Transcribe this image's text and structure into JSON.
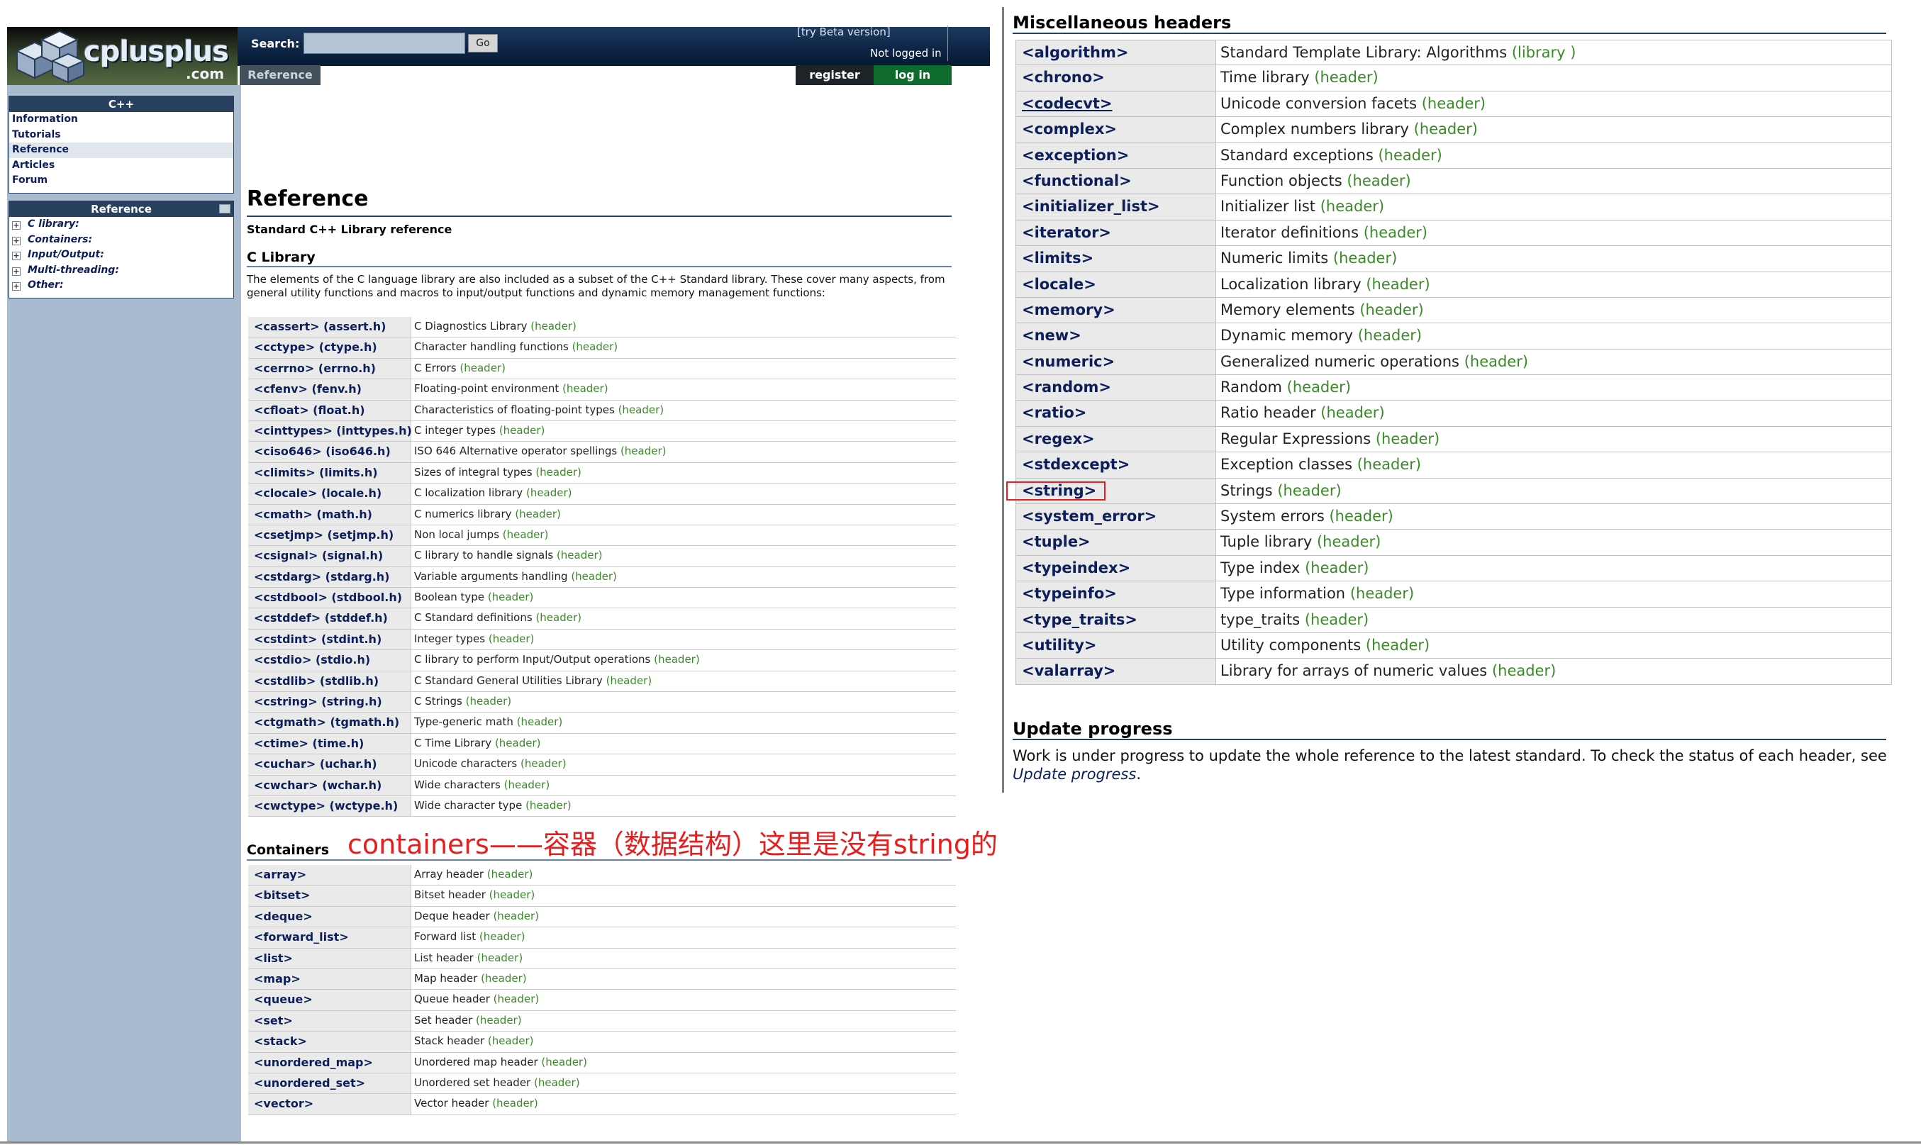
{
  "header": {
    "logo_text": "cplusplus",
    "logo_suffix": ".com",
    "search_label": "Search:",
    "search_value": "",
    "go_label": "Go",
    "beta_link": "[try Beta version]",
    "login_status": "Not logged in",
    "reference_tab": "Reference",
    "register_label": "register",
    "login_label": "log in"
  },
  "sidebar": {
    "cpp_title": "C++",
    "cpp_items": [
      "Information",
      "Tutorials",
      "Reference",
      "Articles",
      "Forum"
    ],
    "active_item": "Reference",
    "reference_title": "Reference",
    "reference_items": [
      "C library:",
      "Containers:",
      "Input/Output:",
      "Multi-threading:",
      "Other:"
    ]
  },
  "main": {
    "title": "Reference",
    "subtitle": "Standard C++ Library reference",
    "clib_title": "C Library",
    "clib_desc": "The elements of the C language library are also included as a subset of the C++ Standard library. These cover many aspects, from general utility functions and macros to input/output functions and dynamic memory management functions:",
    "clib_rows": [
      {
        "name": "<cassert> (assert.h)",
        "desc": "C Diagnostics Library",
        "tag": "(header)"
      },
      {
        "name": "<cctype> (ctype.h)",
        "desc": "Character handling functions",
        "tag": "(header)"
      },
      {
        "name": "<cerrno> (errno.h)",
        "desc": "C Errors",
        "tag": "(header)"
      },
      {
        "name": "<cfenv> (fenv.h)",
        "desc": "Floating-point environment",
        "tag": "(header)"
      },
      {
        "name": "<cfloat> (float.h)",
        "desc": "Characteristics of floating-point types",
        "tag": "(header)"
      },
      {
        "name": "<cinttypes> (inttypes.h)",
        "desc": "C integer types",
        "tag": "(header)"
      },
      {
        "name": "<ciso646> (iso646.h)",
        "desc": "ISO 646 Alternative operator spellings",
        "tag": "(header)"
      },
      {
        "name": "<climits> (limits.h)",
        "desc": "Sizes of integral types",
        "tag": "(header)"
      },
      {
        "name": "<clocale> (locale.h)",
        "desc": "C localization library",
        "tag": "(header)"
      },
      {
        "name": "<cmath> (math.h)",
        "desc": "C numerics library",
        "tag": "(header)"
      },
      {
        "name": "<csetjmp> (setjmp.h)",
        "desc": "Non local jumps",
        "tag": "(header)"
      },
      {
        "name": "<csignal> (signal.h)",
        "desc": "C library to handle signals",
        "tag": "(header)"
      },
      {
        "name": "<cstdarg> (stdarg.h)",
        "desc": "Variable arguments handling",
        "tag": "(header)"
      },
      {
        "name": "<cstdbool> (stdbool.h)",
        "desc": "Boolean type",
        "tag": "(header)"
      },
      {
        "name": "<cstddef> (stddef.h)",
        "desc": "C Standard definitions",
        "tag": "(header)"
      },
      {
        "name": "<cstdint> (stdint.h)",
        "desc": "Integer types",
        "tag": "(header)"
      },
      {
        "name": "<cstdio> (stdio.h)",
        "desc": "C library to perform Input/Output operations",
        "tag": "(header)"
      },
      {
        "name": "<cstdlib> (stdlib.h)",
        "desc": "C Standard General Utilities Library",
        "tag": "(header)"
      },
      {
        "name": "<cstring> (string.h)",
        "desc": "C Strings",
        "tag": "(header)"
      },
      {
        "name": "<ctgmath> (tgmath.h)",
        "desc": "Type-generic math",
        "tag": "(header)"
      },
      {
        "name": "<ctime> (time.h)",
        "desc": "C Time Library",
        "tag": "(header)"
      },
      {
        "name": "<cuchar> (uchar.h)",
        "desc": "Unicode characters",
        "tag": "(header)"
      },
      {
        "name": "<cwchar> (wchar.h)",
        "desc": "Wide characters",
        "tag": "(header)"
      },
      {
        "name": "<cwctype> (wctype.h)",
        "desc": "Wide character type",
        "tag": "(header)"
      }
    ],
    "annotation": "containers——容器（数据结构）这里是没有string的",
    "containers_title": "Containers",
    "containers_rows": [
      {
        "name": "<array>",
        "desc": "Array header",
        "tag": "(header)"
      },
      {
        "name": "<bitset>",
        "desc": "Bitset header",
        "tag": "(header)"
      },
      {
        "name": "<deque>",
        "desc": "Deque header",
        "tag": "(header)"
      },
      {
        "name": "<forward_list>",
        "desc": "Forward list",
        "tag": "(header)"
      },
      {
        "name": "<list>",
        "desc": "List header",
        "tag": "(header)"
      },
      {
        "name": "<map>",
        "desc": "Map header",
        "tag": "(header)"
      },
      {
        "name": "<queue>",
        "desc": "Queue header",
        "tag": "(header)"
      },
      {
        "name": "<set>",
        "desc": "Set header",
        "tag": "(header)"
      },
      {
        "name": "<stack>",
        "desc": "Stack header",
        "tag": "(header)"
      },
      {
        "name": "<unordered_map>",
        "desc": "Unordered map header",
        "tag": "(header)"
      },
      {
        "name": "<unordered_set>",
        "desc": "Unordered set header",
        "tag": "(header)"
      },
      {
        "name": "<vector>",
        "desc": "Vector header",
        "tag": "(header)"
      }
    ]
  },
  "misc": {
    "title": "Miscellaneous headers",
    "rows": [
      {
        "name": "<algorithm>",
        "desc": "Standard Template Library: Algorithms",
        "tag": "(library )"
      },
      {
        "name": "<chrono>",
        "desc": "Time library",
        "tag": "(header)"
      },
      {
        "name": "<codecvt>",
        "desc": "Unicode conversion facets",
        "tag": "(header)"
      },
      {
        "name": "<complex>",
        "desc": "Complex numbers library",
        "tag": "(header)"
      },
      {
        "name": "<exception>",
        "desc": "Standard exceptions",
        "tag": "(header)"
      },
      {
        "name": "<functional>",
        "desc": "Function objects",
        "tag": "(header)"
      },
      {
        "name": "<initializer_list>",
        "desc": "Initializer list",
        "tag": "(header)"
      },
      {
        "name": "<iterator>",
        "desc": "Iterator definitions",
        "tag": "(header)"
      },
      {
        "name": "<limits>",
        "desc": "Numeric limits",
        "tag": "(header)"
      },
      {
        "name": "<locale>",
        "desc": "Localization library",
        "tag": "(header)"
      },
      {
        "name": "<memory>",
        "desc": "Memory elements",
        "tag": "(header)"
      },
      {
        "name": "<new>",
        "desc": "Dynamic memory",
        "tag": "(header)"
      },
      {
        "name": "<numeric>",
        "desc": "Generalized numeric operations",
        "tag": "(header)"
      },
      {
        "name": "<random>",
        "desc": "Random",
        "tag": "(header)"
      },
      {
        "name": "<ratio>",
        "desc": "Ratio header",
        "tag": "(header)"
      },
      {
        "name": "<regex>",
        "desc": "Regular Expressions",
        "tag": "(header)"
      },
      {
        "name": "<stdexcept>",
        "desc": "Exception classes",
        "tag": "(header)"
      },
      {
        "name": "<string>",
        "desc": "Strings",
        "tag": "(header)"
      },
      {
        "name": "<system_error>",
        "desc": "System errors",
        "tag": "(header)"
      },
      {
        "name": "<tuple>",
        "desc": "Tuple library",
        "tag": "(header)"
      },
      {
        "name": "<typeindex>",
        "desc": "Type index",
        "tag": "(header)"
      },
      {
        "name": "<typeinfo>",
        "desc": "Type information",
        "tag": "(header)"
      },
      {
        "name": "<type_traits>",
        "desc": "type_traits",
        "tag": "(header)"
      },
      {
        "name": "<utility>",
        "desc": "Utility components",
        "tag": "(header)"
      },
      {
        "name": "<valarray>",
        "desc": "Library for arrays of numeric values",
        "tag": "(header)"
      }
    ],
    "underlined_row": "<codecvt>",
    "highlighted_row": "<string>",
    "update_title": "Update progress",
    "update_text": "Work is under progress to update the whole reference to the latest standard. To check the status of each header, see",
    "update_link": "Update progress",
    "update_end": "."
  },
  "colors": {
    "header_tag": "#3a8a29",
    "link_navy": "#0c1f5a",
    "annotation_red": "#e61e1e",
    "sidebar_bg": "#a9bbcf"
  },
  "icons": [
    "logo-cubes-icon",
    "plus-icon",
    "collapse-icon"
  ]
}
